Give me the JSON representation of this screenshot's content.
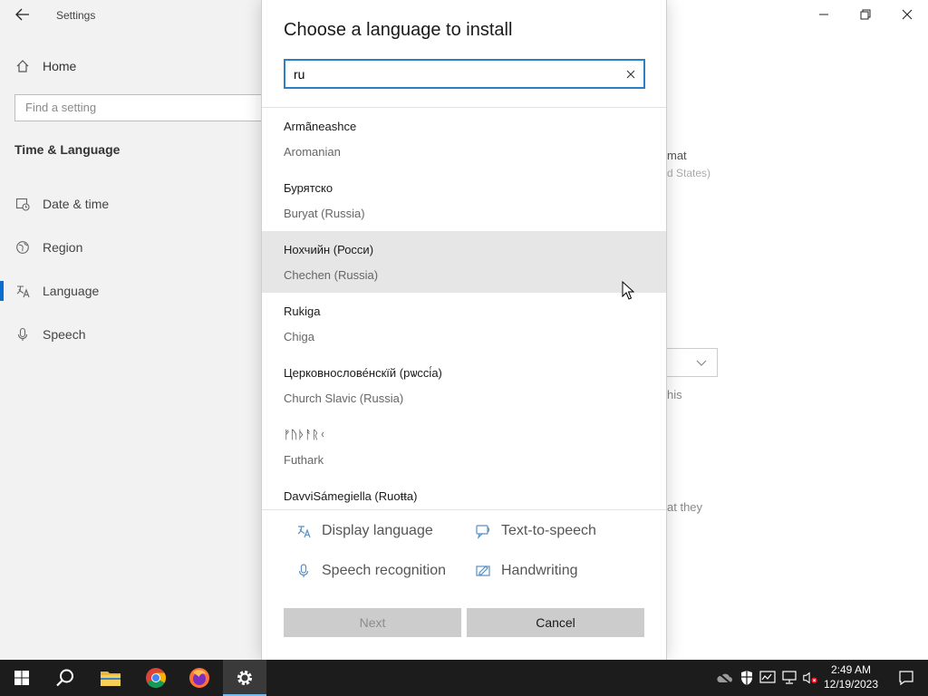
{
  "window": {
    "title": "Settings",
    "back_label": "Back"
  },
  "sidebar": {
    "home_label": "Home",
    "search_placeholder": "Find a setting",
    "section_title": "Time & Language",
    "items": [
      {
        "label": "Date & time",
        "icon": "calendar-clock-icon"
      },
      {
        "label": "Region",
        "icon": "globe-icon"
      },
      {
        "label": "Language",
        "icon": "language-icon",
        "active": true
      },
      {
        "label": "Speech",
        "icon": "microphone-icon"
      }
    ]
  },
  "background": {
    "fragment_1": "mat",
    "fragment_2": "d States)",
    "fragment_3": "his",
    "fragment_4": "at they"
  },
  "dialog": {
    "title": "Choose a language to install",
    "search_value": "ru",
    "languages": [
      {
        "native": "Armãneashce",
        "english": "Aromanian"
      },
      {
        "native": "Бурятско",
        "english": "Buryat (Russia)"
      },
      {
        "native": "Нохчийн (Росси)",
        "english": "Chechen (Russia)",
        "hovered": true
      },
      {
        "native": "Rukiga",
        "english": "Chiga"
      },
      {
        "native": "Церковнослове́нскїй (рѡссі́а)",
        "english": "Church Slavic (Russia)"
      },
      {
        "native": "ᚠᚢᚦᚨᚱᚲ",
        "english": "Futhark"
      },
      {
        "native": "DavviSámegiella (Ruoŧŧa)",
        "english": ""
      }
    ],
    "features": [
      {
        "label": "Display language",
        "icon": "display-language-icon"
      },
      {
        "label": "Text-to-speech",
        "icon": "text-to-speech-icon"
      },
      {
        "label": "Speech recognition",
        "icon": "microphone-icon"
      },
      {
        "label": "Handwriting",
        "icon": "handwriting-icon"
      }
    ],
    "next_label": "Next",
    "cancel_label": "Cancel"
  },
  "taskbar": {
    "apps": [
      "start-icon",
      "search-icon",
      "file-explorer-icon",
      "chrome-icon",
      "firefox-icon",
      "settings-gear-icon"
    ],
    "time": "2:49 AM",
    "date": "12/19/2023"
  },
  "colors": {
    "accent": "#2b7fc4",
    "hover": "#e6e6e6",
    "button": "#cccccc",
    "taskbar": "#1c1c1c"
  }
}
